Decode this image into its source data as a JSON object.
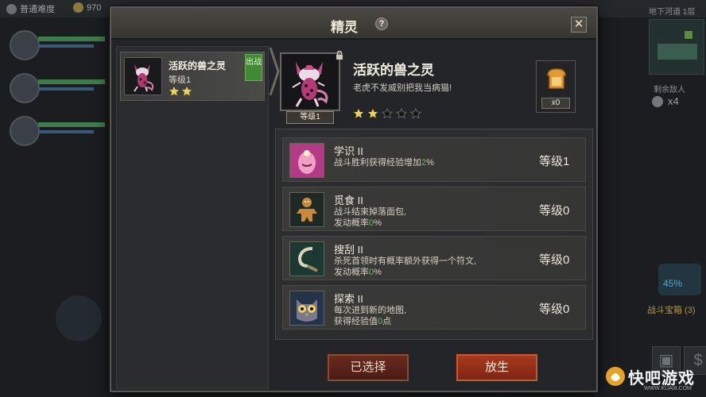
{
  "background": {
    "difficulty": "普通难度",
    "coins": "970",
    "floor": "地下河道 1层",
    "remaining_enemies_label": "剩余敌人",
    "remaining_enemies_count": "x4",
    "chest_percent": "45%",
    "chest_label": "战斗宝箱 (3)"
  },
  "dialog": {
    "title": "精灵",
    "help": "?",
    "close": "✕"
  },
  "spirit_list": [
    {
      "name": "活跃的兽之灵",
      "level": "等级1",
      "stars": 2,
      "tag": "出战"
    }
  ],
  "detail": {
    "name": "活跃的兽之灵",
    "quote": "老虎不发威别把我当病猫!",
    "portrait_level": "等级1",
    "stars_filled": 2,
    "stars_total": 5,
    "food_count": "x0"
  },
  "skills": [
    {
      "name": "学识",
      "rank": "II",
      "desc_pre": "战斗胜利获得经验增加",
      "highlight": "2",
      "desc_post": "%",
      "desc2": "",
      "desc2_hl": "",
      "desc2_post": "",
      "level": "等级1",
      "icon": "mind-icon"
    },
    {
      "name": "觅食",
      "rank": "II",
      "desc_pre": "战斗结束掉落面包,",
      "highlight": "",
      "desc_post": "",
      "desc2": "发动概率",
      "desc2_hl": "0",
      "desc2_post": "%",
      "level": "等级0",
      "icon": "gingerbread-icon"
    },
    {
      "name": "搜刮",
      "rank": "II",
      "desc_pre": "杀死首领时有概率额外获得一个符文,",
      "highlight": "",
      "desc_post": "",
      "desc2": "发动概率",
      "desc2_hl": "0",
      "desc2_post": "%",
      "level": "等级0",
      "icon": "hook-icon"
    },
    {
      "name": "探索",
      "rank": "II",
      "desc_pre": "每次进到新的地图,",
      "highlight": "",
      "desc_post": "",
      "desc2": "获得经验值",
      "desc2_hl": "0",
      "desc2_post": "点",
      "level": "等级0",
      "icon": "owl-icon"
    }
  ],
  "buttons": {
    "selected": "已选择",
    "release": "放生"
  },
  "watermark": {
    "text": "快吧游戏",
    "url": "WWW.KUAI8.COM"
  }
}
